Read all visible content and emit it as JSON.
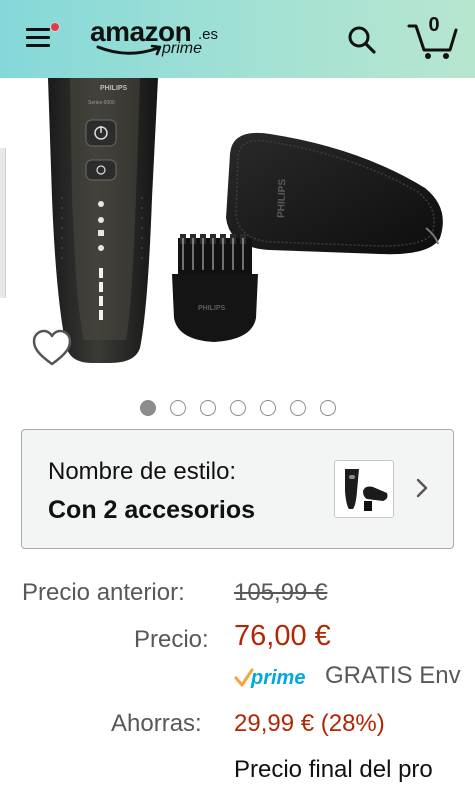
{
  "header": {
    "logo_text": "amazon",
    "logo_domain": ".es",
    "logo_sub": "prime",
    "cart_count": "0",
    "icons": [
      "menu-icon",
      "search-icon",
      "cart-icon"
    ],
    "notification_color": "#e8384f"
  },
  "gallery": {
    "brand_on_shaver": "PHILIPS",
    "series_on_shaver": "Series 6000",
    "brand_on_case": "PHILIPS",
    "brand_on_trimmer": "PHILIPS",
    "image_count": 7,
    "active_index": 0
  },
  "style_selector": {
    "label": "Nombre de estilo:",
    "value": "Con 2 accesorios"
  },
  "pricing": {
    "old_price_label": "Precio anterior:",
    "old_price": "105,99 €",
    "price_label": "Precio:",
    "price": "76,00 €",
    "prime_label": "prime",
    "shipping_text": "GRATIS Env",
    "savings_label": "Ahorras:",
    "savings_value": "29,99 € (28%)",
    "final_price_text": "Precio final del pro",
    "price_color": "#b12704",
    "prime_check_color": "#f3a847",
    "prime_text_color": "#00a8e1"
  }
}
